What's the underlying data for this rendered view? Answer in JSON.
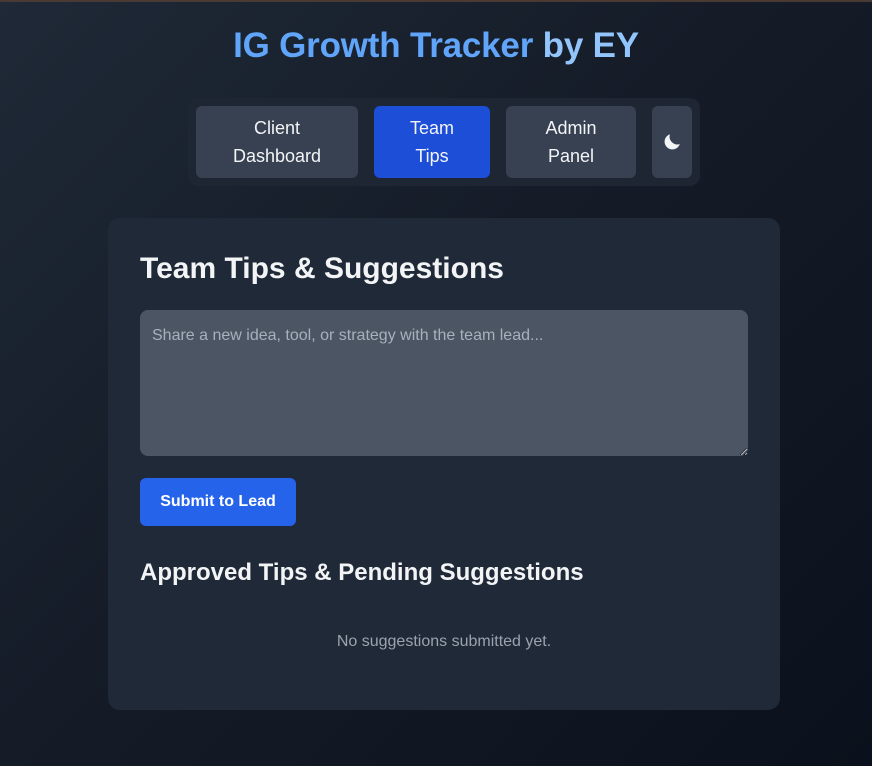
{
  "header": {
    "title_main": "IG Growth Tracker",
    "title_suffix": " by EY"
  },
  "nav": {
    "tabs": [
      {
        "label": "Client\nDashboard",
        "active": false
      },
      {
        "label": "Team\nTips",
        "active": true
      },
      {
        "label": "Admin\nPanel",
        "active": false
      }
    ],
    "theme_toggle_icon": "moon-icon"
  },
  "tips": {
    "heading": "Team Tips & Suggestions",
    "input_placeholder": "Share a new idea, tool, or strategy with the team lead...",
    "input_value": "",
    "submit_label": "Submit to Lead",
    "list_heading": "Approved Tips & Pending Suggestions",
    "empty_message": "No suggestions submitted yet."
  },
  "colors": {
    "accent": "#60a5fa",
    "active_tab": "#1d4ed8",
    "primary_button": "#2563eb",
    "card_bg": "#1f2937"
  }
}
